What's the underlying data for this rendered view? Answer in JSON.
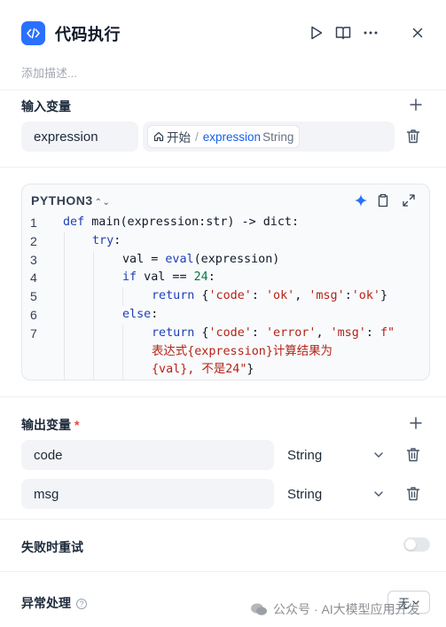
{
  "header": {
    "icon": "code-icon",
    "title": "代码执行",
    "actions": [
      "run-icon",
      "panel-split-icon",
      "more-icon",
      "close-icon"
    ],
    "description_placeholder": "添加描述..."
  },
  "inputs": {
    "label": "输入变量",
    "rows": [
      {
        "name": "expression",
        "ref_start": "开始",
        "ref_separator": "/",
        "ref_var": "expression",
        "ref_type": "String"
      }
    ]
  },
  "editor": {
    "language": "PYTHON3",
    "language_chevron": "⌃",
    "lines": [
      {
        "n": "1",
        "indent": 0,
        "html_text": "def main(expression:str) -> dict:"
      },
      {
        "n": "2",
        "indent": 1,
        "html_text": "try:"
      },
      {
        "n": "3",
        "indent": 2,
        "html_text": "val = eval(expression)"
      },
      {
        "n": "4",
        "indent": 2,
        "html_text": "if val == 24:"
      },
      {
        "n": "5",
        "indent": 3,
        "html_text": "return {'code': 'ok', 'msg':'ok'}"
      },
      {
        "n": "6",
        "indent": 2,
        "html_text": "else:"
      },
      {
        "n": "7",
        "indent": 3,
        "html_text": "return {'code': 'error', 'msg': f\"表达式{expression}计算结果为{val}, 不是24\"}"
      }
    ]
  },
  "outputs": {
    "label": "输出变量",
    "required_mark": "*",
    "rows": [
      {
        "name": "code",
        "type": "String"
      },
      {
        "name": "msg",
        "type": "String"
      }
    ]
  },
  "retry": {
    "label": "失败时重试",
    "enabled": false
  },
  "error_handling": {
    "label": "异常处理",
    "help": "?",
    "value": "无"
  },
  "watermark": {
    "text": "公众号 · AI大模型应用开发"
  },
  "colors": {
    "accent": "#2970ff",
    "link": "#155eef",
    "string": "#b42318",
    "keyword": "#1d3fb8"
  }
}
